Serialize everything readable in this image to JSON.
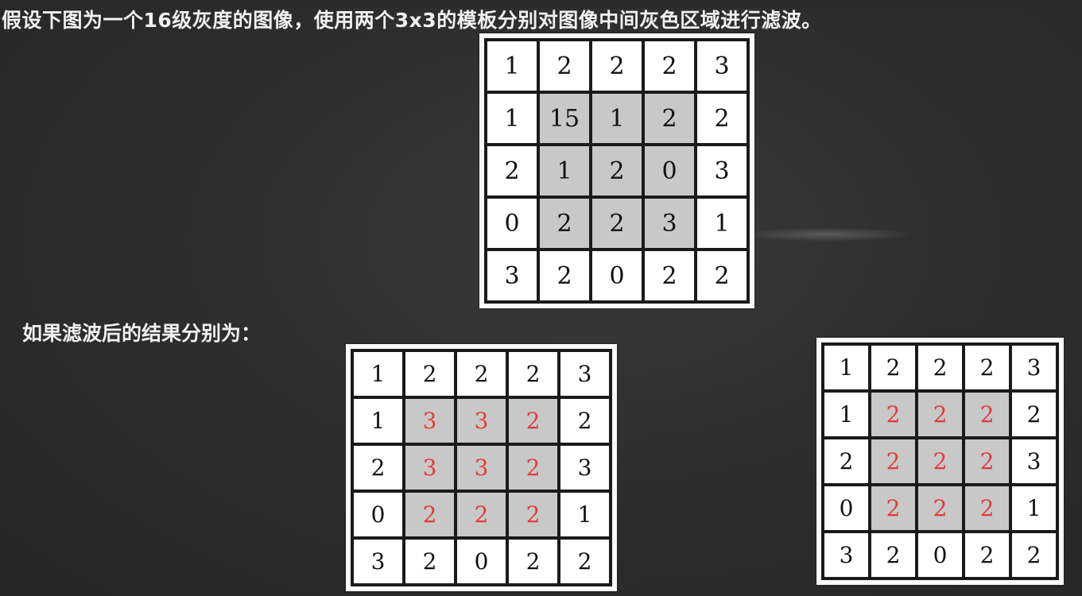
{
  "question": "假设下图为一个16级灰度的图像，使用两个3x3的模板分别对图像中间灰色区域进行滤波。",
  "results_label": "如果滤波后的结果分别为：",
  "original": [
    [
      "1",
      "2",
      "2",
      "2",
      "3"
    ],
    [
      "1",
      "15",
      "1",
      "2",
      "2"
    ],
    [
      "2",
      "1",
      "2",
      "0",
      "3"
    ],
    [
      "0",
      "2",
      "2",
      "3",
      "1"
    ],
    [
      "3",
      "2",
      "0",
      "2",
      "2"
    ]
  ],
  "result_a": [
    [
      "1",
      "2",
      "2",
      "2",
      "3"
    ],
    [
      "1",
      "3",
      "3",
      "2",
      "2"
    ],
    [
      "2",
      "3",
      "3",
      "2",
      "3"
    ],
    [
      "0",
      "2",
      "2",
      "2",
      "1"
    ],
    [
      "3",
      "2",
      "0",
      "2",
      "2"
    ]
  ],
  "result_b": [
    [
      "1",
      "2",
      "2",
      "2",
      "3"
    ],
    [
      "1",
      "2",
      "2",
      "2",
      "2"
    ],
    [
      "2",
      "2",
      "2",
      "2",
      "3"
    ],
    [
      "0",
      "2",
      "2",
      "2",
      "1"
    ],
    [
      "3",
      "2",
      "0",
      "2",
      "2"
    ]
  ],
  "colors": {
    "center_gray": "#c8c8c8",
    "filtered_red": "#e23b3b"
  }
}
